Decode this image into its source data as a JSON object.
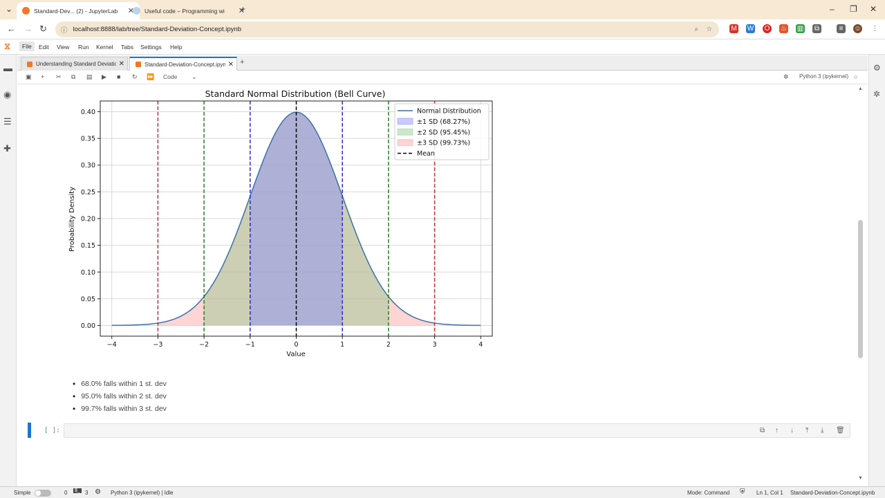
{
  "browser": {
    "tabs": [
      {
        "label": "Standard-Dev... (2) - JupyterLab",
        "active": true
      },
      {
        "label": "Useful code – Programming wi",
        "active": false
      }
    ],
    "new_tab": "+",
    "url": "localhost:8888/lab/tree/Standard-Deviation-Concept.ipynb",
    "window_controls": [
      "–",
      "❐",
      "✕"
    ]
  },
  "jupyter": {
    "menu": [
      "File",
      "Edit",
      "View",
      "Run",
      "Kernel",
      "Tabs",
      "Settings",
      "Help"
    ],
    "doc_tabs": [
      {
        "label": "Understanding Standard Deviation",
        "active": false
      },
      {
        "label": "Standard-Deviation-Concept.ipynb",
        "active": true
      }
    ],
    "cell_type": "Code",
    "kernel": "Python 3 (ipykernel)",
    "prompt": "[ ]:",
    "bullets": [
      "68.0% falls within 1 st. dev",
      "95.0% falls within 2 st. dev",
      "99.7% falls within 3 st. dev"
    ],
    "status": {
      "mode_label": "Simple",
      "count1": "0",
      "count2": "3",
      "kernel_status": "Python 3 (ipykernel) | Idle",
      "mode": "Mode: Command",
      "position": "Ln 1, Col 1",
      "file": "Standard-Deviation-Concept.ipynb"
    }
  },
  "chart_data": {
    "type": "area",
    "title": "Standard Normal Distribution (Bell Curve)",
    "xlabel": "Value",
    "ylabel": "Probability Density",
    "xlim": [
      -4.25,
      4.25
    ],
    "ylim": [
      -0.02,
      0.42
    ],
    "xticks": [
      "−4",
      "−3",
      "−2",
      "−1",
      "0",
      "1",
      "2",
      "3",
      "4"
    ],
    "yticks": [
      "0.00",
      "0.05",
      "0.10",
      "0.15",
      "0.20",
      "0.25",
      "0.30",
      "0.35",
      "0.40"
    ],
    "grid": true,
    "legend_position": "top-right",
    "series": [
      {
        "name": "Normal Distribution",
        "kind": "line",
        "color": "#3a6fa8",
        "function": "standard normal pdf",
        "x_range": [
          -4,
          4
        ]
      },
      {
        "name": "±1 SD (68.27%)",
        "kind": "fill",
        "color": "#8a8aff",
        "x_range": [
          -1,
          1
        ]
      },
      {
        "name": "±2 SD (95.45%)",
        "kind": "fill",
        "color": "#8fc98f",
        "x_range": [
          -2,
          2
        ]
      },
      {
        "name": "±3 SD (99.73%)",
        "kind": "fill",
        "color": "#ff9f9f",
        "x_range": [
          -3,
          3
        ]
      },
      {
        "name": "Mean",
        "kind": "vline",
        "color": "#000000",
        "x": 0
      }
    ],
    "vlines": [
      {
        "x": -3,
        "color": "#c03030"
      },
      {
        "x": 3,
        "color": "#c03030"
      },
      {
        "x": -2,
        "color": "#2a7a2a"
      },
      {
        "x": 2,
        "color": "#2a7a2a"
      },
      {
        "x": -1,
        "color": "#2a2ad0"
      },
      {
        "x": 1,
        "color": "#2a2ad0"
      },
      {
        "x": 0,
        "color": "#000000"
      }
    ]
  }
}
